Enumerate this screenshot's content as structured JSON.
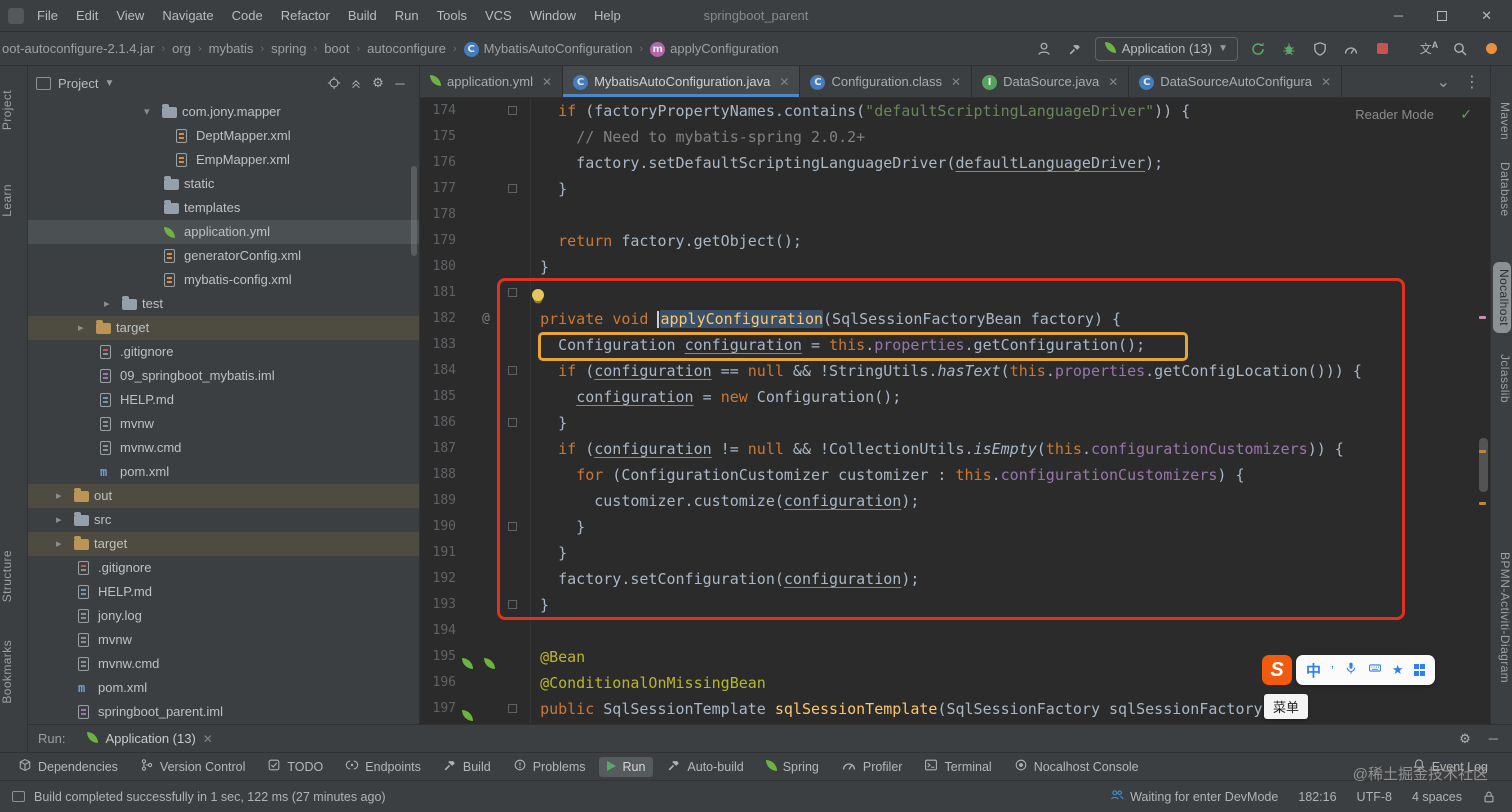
{
  "titlebar": {
    "menu_items": [
      "File",
      "Edit",
      "View",
      "Navigate",
      "Code",
      "Refactor",
      "Build",
      "Run",
      "Tools",
      "VCS",
      "Window",
      "Help"
    ],
    "title": "springboot_parent"
  },
  "navbar": {
    "breadcrumbs": [
      {
        "label": "oot-autoconfigure-2.1.4.jar"
      },
      {
        "label": "org"
      },
      {
        "label": "mybatis"
      },
      {
        "label": "spring"
      },
      {
        "label": "boot"
      },
      {
        "label": "autoconfigure"
      },
      {
        "label": "MybatisAutoConfiguration",
        "icon": "class"
      },
      {
        "label": "applyConfiguration",
        "icon": "method"
      }
    ],
    "run_config_label": "Application (13)",
    "tools": [
      "rerun",
      "debug",
      "coverage",
      "profiler",
      "stop",
      "translate",
      "search",
      "updates"
    ]
  },
  "tabs": [
    {
      "label": "application.yml",
      "icon": "leaf"
    },
    {
      "label": "MybatisAutoConfiguration.java",
      "icon": "class",
      "active": true
    },
    {
      "label": "Configuration.class",
      "icon": "class"
    },
    {
      "label": "DataSource.java",
      "icon": "iface"
    },
    {
      "label": "DataSourceAutoConfigura",
      "icon": "class"
    }
  ],
  "project_panel": {
    "title": "Project",
    "tree": [
      {
        "label": "com.jony.mapper",
        "icon": "folder",
        "indent": 116,
        "chev": "open"
      },
      {
        "label": "DeptMapper.xml",
        "icon": "xml",
        "indent": 148
      },
      {
        "label": "EmpMapper.xml",
        "icon": "xml",
        "indent": 148
      },
      {
        "label": "static",
        "icon": "folder",
        "indent": 136
      },
      {
        "label": "templates",
        "icon": "folder",
        "indent": 136
      },
      {
        "label": "application.yml",
        "icon": "leaf",
        "indent": 136,
        "selected": true
      },
      {
        "label": "generatorConfig.xml",
        "icon": "xml",
        "indent": 136
      },
      {
        "label": "mybatis-config.xml",
        "icon": "xml",
        "indent": 136
      },
      {
        "label": "test",
        "icon": "folder",
        "indent": 76,
        "chev": "closed"
      },
      {
        "label": "target",
        "icon": "folderex",
        "indent": 50,
        "chev": "closed",
        "excluded": true
      },
      {
        "label": ".gitignore",
        "icon": "git",
        "indent": 72
      },
      {
        "label": "09_springboot_mybatis.iml",
        "icon": "iml",
        "indent": 72
      },
      {
        "label": "HELP.md",
        "icon": "md",
        "indent": 72
      },
      {
        "label": "mvnw",
        "icon": "txt",
        "indent": 72
      },
      {
        "label": "mvnw.cmd",
        "icon": "cmd",
        "indent": 72
      },
      {
        "label": "pom.xml",
        "icon": "maven",
        "indent": 72
      },
      {
        "label": "out",
        "icon": "folderex",
        "indent": 28,
        "chev": "closed",
        "excluded": true
      },
      {
        "label": "src",
        "icon": "folder",
        "indent": 28,
        "chev": "closed"
      },
      {
        "label": "target",
        "icon": "folderex",
        "indent": 28,
        "chev": "closed",
        "excluded": true
      },
      {
        "label": ".gitignore",
        "icon": "git",
        "indent": 50
      },
      {
        "label": "HELP.md",
        "icon": "md",
        "indent": 50
      },
      {
        "label": "jony.log",
        "icon": "txt",
        "indent": 50
      },
      {
        "label": "mvnw",
        "icon": "txt",
        "indent": 50
      },
      {
        "label": "mvnw.cmd",
        "icon": "cmd",
        "indent": 50
      },
      {
        "label": "pom.xml",
        "icon": "maven",
        "indent": 50
      },
      {
        "label": "springboot_parent.iml",
        "icon": "iml",
        "indent": 50
      }
    ]
  },
  "editor": {
    "reader_mode_label": "Reader Mode",
    "lines": [
      {
        "n": "174",
        "fold": true,
        "segs": [
          [
            "    ",
            "p"
          ],
          [
            "if",
            "k"
          ],
          [
            " (factoryPropertyNames.contains(",
            "p"
          ],
          [
            "\"defaultScriptingLanguageDriver\"",
            "s"
          ],
          [
            ")) {",
            "p"
          ]
        ]
      },
      {
        "n": "175",
        "segs": [
          [
            "      ",
            "p"
          ],
          [
            "// Need to mybatis-spring 2.0.2+",
            "c"
          ]
        ]
      },
      {
        "n": "176",
        "segs": [
          [
            "      factory.setDefaultScriptingLanguageDriver(",
            "p"
          ],
          [
            "defaultLanguageDriver",
            "u"
          ],
          [
            ");",
            "p"
          ]
        ]
      },
      {
        "n": "177",
        "fold": true,
        "segs": [
          [
            "    }",
            "p"
          ]
        ]
      },
      {
        "n": "178",
        "segs": []
      },
      {
        "n": "179",
        "segs": [
          [
            "    ",
            "p"
          ],
          [
            "return",
            "k"
          ],
          [
            " factory.getObject();",
            "p"
          ]
        ]
      },
      {
        "n": "180",
        "segs": [
          [
            "  }",
            "p"
          ]
        ]
      },
      {
        "n": "181",
        "fold": true,
        "segs": []
      },
      {
        "n": "182",
        "gutter": "@",
        "segs": [
          [
            "  ",
            "p"
          ],
          [
            "private",
            "k"
          ],
          [
            " ",
            "p"
          ],
          [
            "void",
            "k"
          ],
          [
            " ",
            "p"
          ],
          [
            "",
            "caret"
          ],
          [
            "applyConfiguration",
            "hl"
          ],
          [
            "(SqlSessionFactoryBean factory) {",
            "p"
          ]
        ]
      },
      {
        "n": "183",
        "segs": [
          [
            "    Configuration ",
            "p"
          ],
          [
            "configuration",
            "u"
          ],
          [
            " = ",
            "p"
          ],
          [
            "this",
            "k"
          ],
          [
            ".",
            "p"
          ],
          [
            "properties",
            "f"
          ],
          [
            ".getConfiguration();",
            "p"
          ]
        ]
      },
      {
        "n": "184",
        "fold": true,
        "segs": [
          [
            "    ",
            "p"
          ],
          [
            "if",
            "k"
          ],
          [
            " (",
            "p"
          ],
          [
            "configuration",
            "u"
          ],
          [
            " == ",
            "p"
          ],
          [
            "null",
            "k"
          ],
          [
            " && !StringUtils.",
            "p"
          ],
          [
            "hasText",
            "si"
          ],
          [
            "(",
            "p"
          ],
          [
            "this",
            "k"
          ],
          [
            ".",
            "p"
          ],
          [
            "properties",
            "f"
          ],
          [
            ".getConfigLocation())) {",
            "p"
          ]
        ]
      },
      {
        "n": "185",
        "segs": [
          [
            "      ",
            "p"
          ],
          [
            "configuration",
            "u"
          ],
          [
            " = ",
            "p"
          ],
          [
            "new",
            "k"
          ],
          [
            " Configuration();",
            "p"
          ]
        ]
      },
      {
        "n": "186",
        "fold": true,
        "segs": [
          [
            "    }",
            "p"
          ]
        ]
      },
      {
        "n": "187",
        "segs": [
          [
            "    ",
            "p"
          ],
          [
            "if",
            "k"
          ],
          [
            " (",
            "p"
          ],
          [
            "configuration",
            "u"
          ],
          [
            " != ",
            "p"
          ],
          [
            "null",
            "k"
          ],
          [
            " && !CollectionUtils.",
            "p"
          ],
          [
            "isEmpty",
            "si"
          ],
          [
            "(",
            "p"
          ],
          [
            "this",
            "k"
          ],
          [
            ".",
            "p"
          ],
          [
            "configurationCustomizers",
            "f"
          ],
          [
            ")) {",
            "p"
          ]
        ]
      },
      {
        "n": "188",
        "segs": [
          [
            "      ",
            "p"
          ],
          [
            "for",
            "k"
          ],
          [
            " (ConfigurationCustomizer customizer : ",
            "p"
          ],
          [
            "this",
            "k"
          ],
          [
            ".",
            "p"
          ],
          [
            "configurationCustomizers",
            "f"
          ],
          [
            ") {",
            "p"
          ]
        ]
      },
      {
        "n": "189",
        "segs": [
          [
            "        customizer.customize(",
            "p"
          ],
          [
            "configuration",
            "u"
          ],
          [
            ");",
            "p"
          ]
        ]
      },
      {
        "n": "190",
        "fold": true,
        "segs": [
          [
            "      }",
            "p"
          ]
        ]
      },
      {
        "n": "191",
        "segs": [
          [
            "    }",
            "p"
          ]
        ]
      },
      {
        "n": "192",
        "segs": [
          [
            "    factory.setConfiguration(",
            "p"
          ],
          [
            "configuration",
            "u"
          ],
          [
            ");",
            "p"
          ]
        ]
      },
      {
        "n": "193",
        "fold": true,
        "segs": [
          [
            "  }",
            "p"
          ]
        ]
      },
      {
        "n": "194",
        "segs": []
      },
      {
        "n": "195",
        "gutter": "beans",
        "segs": [
          [
            "  ",
            "p"
          ],
          [
            "@Bean",
            "a"
          ]
        ]
      },
      {
        "n": "196",
        "segs": [
          [
            "  ",
            "p"
          ],
          [
            "@ConditionalOnMissingBean",
            "a"
          ]
        ]
      },
      {
        "n": "197",
        "gutter": "bean",
        "fold": true,
        "segs": [
          [
            "  ",
            "p"
          ],
          [
            "public",
            "k"
          ],
          [
            " SqlSessionTemplate ",
            "p"
          ],
          [
            "sqlSessionTemplate",
            "d"
          ],
          [
            "(SqlSessionFactory sqlSessionFactory) {",
            "p"
          ]
        ]
      }
    ],
    "ime": {
      "logo": "S",
      "mode": "中",
      "candidate": "菜单"
    }
  },
  "run_bar": {
    "label": "Run:",
    "tab_label": "Application (13)"
  },
  "bottom_bar": {
    "left": [
      {
        "label": "Dependencies",
        "icon": "box"
      },
      {
        "label": "Version Control",
        "icon": "branch"
      },
      {
        "label": "TODO",
        "icon": "todo"
      },
      {
        "label": "Endpoints",
        "icon": "endpoint"
      },
      {
        "label": "Build",
        "icon": "hammer"
      },
      {
        "label": "Problems",
        "icon": "problems"
      },
      {
        "label": "Run",
        "icon": "play",
        "active": true
      },
      {
        "label": "Auto-build",
        "icon": "hammer"
      },
      {
        "label": "Spring",
        "icon": "leaf"
      },
      {
        "label": "Profiler",
        "icon": "profiler"
      },
      {
        "label": "Terminal",
        "icon": "terminal"
      },
      {
        "label": "Nocalhost Console",
        "icon": "nocal"
      }
    ],
    "right": [
      {
        "label": "Event Log",
        "icon": "bell"
      }
    ]
  },
  "status_bar": {
    "message": "Build completed successfully in 1 sec, 122 ms (27 minutes ago)",
    "devmode": "Waiting for enter DevMode",
    "position": "182:16",
    "encoding": "UTF-8",
    "indent": "4 spaces",
    "watermark": "@稀土掘金技术社区"
  },
  "left_strip": {
    "top": [
      {
        "label": "Project"
      },
      {
        "label": "Learn"
      }
    ],
    "bottom": [
      {
        "label": "Structure"
      },
      {
        "label": "Bookmarks"
      }
    ]
  },
  "right_strip": {
    "items": [
      {
        "label": "Maven"
      },
      {
        "label": "Database"
      },
      {
        "label": "Nocalhost",
        "selected": true
      },
      {
        "label": "Jclasslib"
      },
      {
        "label": "BPMN-Activiti-Diagram"
      }
    ]
  }
}
